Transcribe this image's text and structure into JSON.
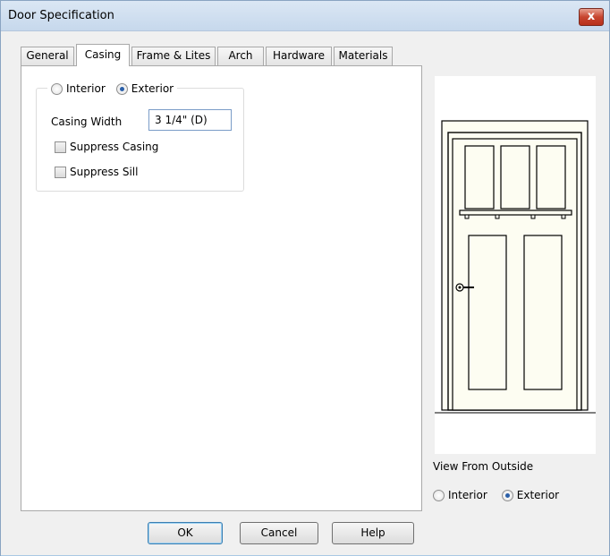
{
  "window": {
    "title": "Door Specification",
    "close_label": "x"
  },
  "tabs": [
    {
      "label": "General"
    },
    {
      "label": "Casing"
    },
    {
      "label": "Frame & Lites"
    },
    {
      "label": "Arch"
    },
    {
      "label": "Hardware"
    },
    {
      "label": "Materials"
    }
  ],
  "active_tab": "Casing",
  "casing": {
    "interior_label": "Interior",
    "exterior_label": "Exterior",
    "selected_side": "Exterior",
    "width_label": "Casing Width",
    "width_value": "3 1/4\" (D)",
    "suppress_casing_label": "Suppress Casing",
    "suppress_casing_checked": false,
    "suppress_sill_label": "Suppress Sill",
    "suppress_sill_checked": false
  },
  "preview": {
    "caption": "View From Outside",
    "interior_label": "Interior",
    "exterior_label": "Exterior",
    "selected": "Exterior"
  },
  "buttons": {
    "ok": "OK",
    "cancel": "Cancel",
    "help": "Help"
  },
  "colors": {
    "accent": "#2a5fa8",
    "door_fill": "#fdfdf2",
    "titlebar": "#c6d8ec"
  }
}
